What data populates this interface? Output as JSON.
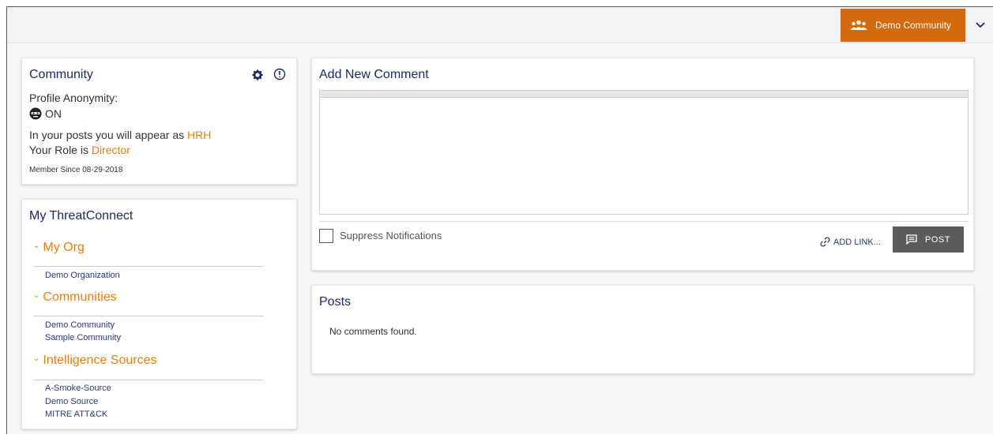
{
  "topbar": {
    "community_label": "Demo Community",
    "accent_color": "#d46a0e"
  },
  "community_card": {
    "title": "Community",
    "profile_anonymity_label": "Profile Anonymity:",
    "anonymity_state": "ON",
    "appear_as_prefix": "In your posts you will appear as ",
    "appear_as_value": "HRH",
    "role_prefix": "Your Role is ",
    "role_value": "Director",
    "member_since": "Member Since 08-29-2018"
  },
  "my_threatconnect": {
    "title": "My ThreatConnect",
    "sections": [
      {
        "label": "My Org",
        "items": [
          "Demo Organization"
        ]
      },
      {
        "label": "Communities",
        "items": [
          "Demo Community",
          "Sample Community"
        ]
      },
      {
        "label": "Intelligence Sources",
        "items": [
          "A-Smoke-Source",
          "Demo Source",
          "MITRE ATT&CK"
        ]
      }
    ]
  },
  "add_comment": {
    "title": "Add New Comment",
    "suppress_label": "Suppress Notifications",
    "add_link_label": "ADD LINK...",
    "post_label": "POST"
  },
  "posts": {
    "title": "Posts",
    "empty_message": "No comments found."
  }
}
